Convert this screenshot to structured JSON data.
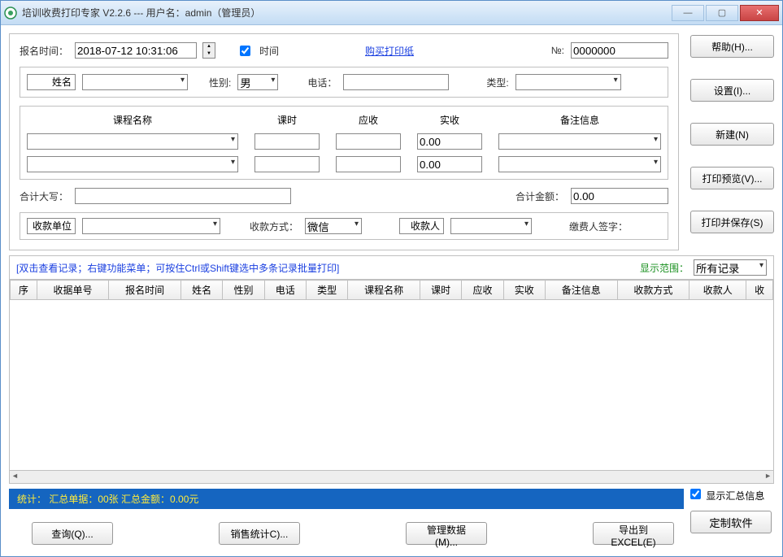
{
  "window": {
    "title": "培训收费打印专家 V2.2.6 --- 用户名：admin（管理员）"
  },
  "form": {
    "datetime_label": "报名时间：",
    "datetime_value": "2018-07-12 10:31:06",
    "time_checkbox": "时间",
    "buy_paper_link": "购买打印纸",
    "no_label": "№:",
    "no_value": "0000000",
    "name_btn": "姓名",
    "gender_label": "性别:",
    "gender_value": "男",
    "phone_label": "电话：",
    "type_label": "类型:",
    "headers": {
      "course": "课程名称",
      "hours": "课时",
      "receivable": "应收",
      "received": "实收",
      "remark": "备注信息"
    },
    "received_default": "0.00",
    "total_text_label": "合计大写：",
    "total_amount_label": "合计金额：",
    "total_amount_value": "0.00",
    "unit_btn": "收款单位",
    "method_label": "收款方式：",
    "method_value": "微信",
    "payee_btn": "收款人",
    "signature_label": "缴费人签字："
  },
  "side": {
    "help": "帮助(H)...",
    "settings": "设置(I)...",
    "new": "新建(N)",
    "preview": "打印预览(V)...",
    "print_save": "打印并保存(S)"
  },
  "records": {
    "hint": "[双击查看记录；右键功能菜单；可按住Ctrl或Shift键选中多条记录批量打印]",
    "range_label": "显示范围：",
    "range_value": "所有记录",
    "columns": [
      "序",
      "收据单号",
      "报名时间",
      "姓名",
      "性别",
      "电话",
      "类型",
      "课程名称",
      "课时",
      "应收",
      "实收",
      "备注信息",
      "收款方式",
      "收款人",
      "收"
    ]
  },
  "stats": {
    "text": "统计：  汇总单据：00张      汇总金额：0.00元"
  },
  "bottom": {
    "show_summary": "显示汇总信息",
    "query": "查询(Q)...",
    "sales_stats": "销售统计C)...",
    "manage_data": "管理数据(M)...",
    "export_excel": "导出到EXCEL(E)",
    "customize": "定制软件"
  }
}
